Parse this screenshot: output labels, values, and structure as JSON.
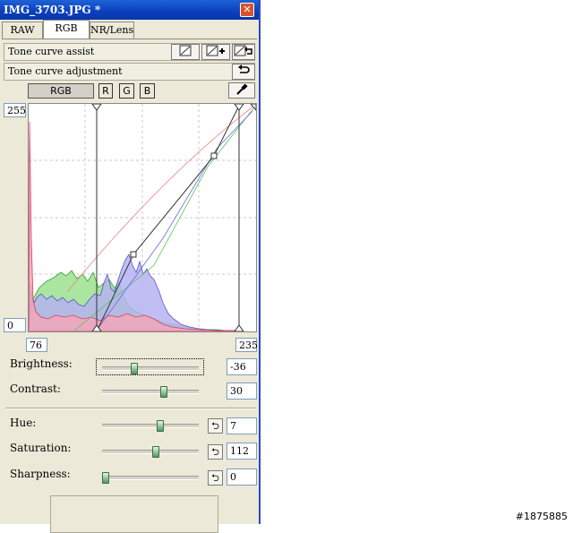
{
  "window": {
    "title": "IMG_3703.JPG *"
  },
  "tabs": [
    {
      "label": "RAW"
    },
    {
      "label": "RGB"
    },
    {
      "label": "NR/Lens"
    }
  ],
  "tone_curve_assist": {
    "label": "Tone curve assist"
  },
  "tone_curve_adjustment": {
    "label": "Tone curve adjustment"
  },
  "channels": [
    {
      "label": "RGB"
    },
    {
      "label": "R"
    },
    {
      "label": "G"
    },
    {
      "label": "B"
    }
  ],
  "curve": {
    "input_max": "255",
    "input_min": "0",
    "black_point": "76",
    "white_point": "235"
  },
  "sliders": {
    "brightness": {
      "label": "Brightness:",
      "value": "-36",
      "position": 0.32
    },
    "contrast": {
      "label": "Contrast:",
      "value": "30",
      "position": 0.65
    },
    "hue": {
      "label": "Hue:",
      "value": "7",
      "position": 0.61
    },
    "saturation": {
      "label": "Saturation:",
      "value": "112",
      "position": 0.56
    },
    "sharpness": {
      "label": "Sharpness:",
      "value": "0",
      "position": 0.0
    }
  },
  "watermark": "#1875885",
  "colors": {
    "titlebar": "#0a3fbd",
    "panel_bg": "#ece9d8",
    "slider_thumb": "#4f9a5f"
  }
}
